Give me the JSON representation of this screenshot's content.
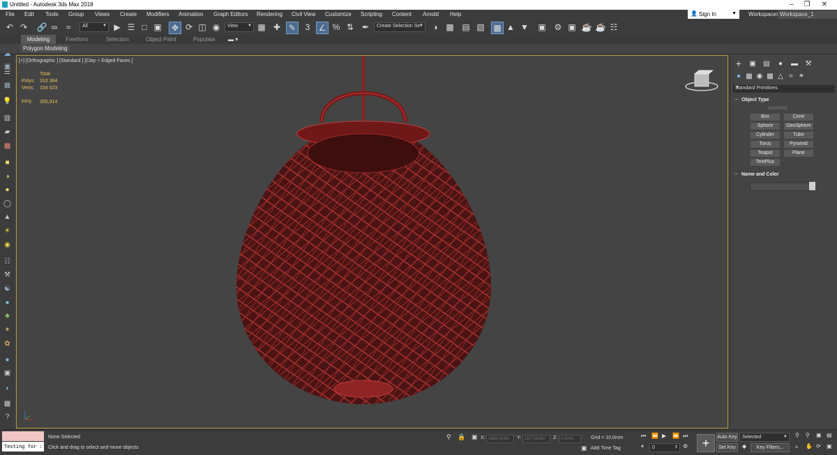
{
  "window": {
    "title": "Untitled - Autodesk 3ds Max 2018"
  },
  "menu": [
    "File",
    "Edit",
    "Tools",
    "Group",
    "Views",
    "Create",
    "Modifiers",
    "Animation",
    "Graph Editors",
    "Rendering",
    "Civil View",
    "Customize",
    "Scripting",
    "Content",
    "Arnold",
    "Help"
  ],
  "account": {
    "sign_in": "Sign In",
    "workspaces_label": "Workspaces:",
    "workspace": "Workspace_1"
  },
  "toolbar": {
    "selection_filter": "All",
    "reference_coord": "View",
    "named_selection": "Create Selection Se",
    "snap_angle": "3",
    "snap_percent": "%"
  },
  "ribbon": {
    "tabs": [
      "Modeling",
      "Freeform",
      "Selection",
      "Object Paint",
      "Populate"
    ],
    "active_tab": "Modeling",
    "sub": "Polygon Modeling"
  },
  "viewport": {
    "label": "[+] [Orthographic ] [Standard ] [Clay + Edged Faces ]",
    "stats": {
      "total_label": "Total",
      "polys_label": "Polys:",
      "polys": "310 384",
      "verts_label": "Verts:",
      "verts": "154 023",
      "fps_label": "FPS:",
      "fps": "350,914"
    },
    "colors": {
      "mesh": "#7a1a1a",
      "wire": "#b83232",
      "background": "#444444"
    }
  },
  "command_panel": {
    "category": "Standard Primitives",
    "object_type_title": "Object Type",
    "autogrid": "AutoGrid",
    "buttons": [
      "Box",
      "Cone",
      "Sphere",
      "GeoSphere",
      "Cylinder",
      "Tube",
      "Torus",
      "Pyramid",
      "Teapot",
      "Plane",
      "TextPlus"
    ],
    "name_color_title": "Name and Color"
  },
  "status": {
    "selection": "None Selected",
    "prompt": "Click and drag to select and move objects",
    "x_label": "X:",
    "x": "1962,413m",
    "y_label": "Y:",
    "y": "1577,613m",
    "z_label": "Z:",
    "z": "0,0mm",
    "grid": "Grid = 10,0mm",
    "add_time_tag": "Add Time Tag",
    "frame": "0",
    "auto_key": "Auto Key",
    "set_key": "Set Key",
    "key_mode": "Selected",
    "key_filters": "Key Filters...",
    "maxscript": "Testing for :"
  }
}
